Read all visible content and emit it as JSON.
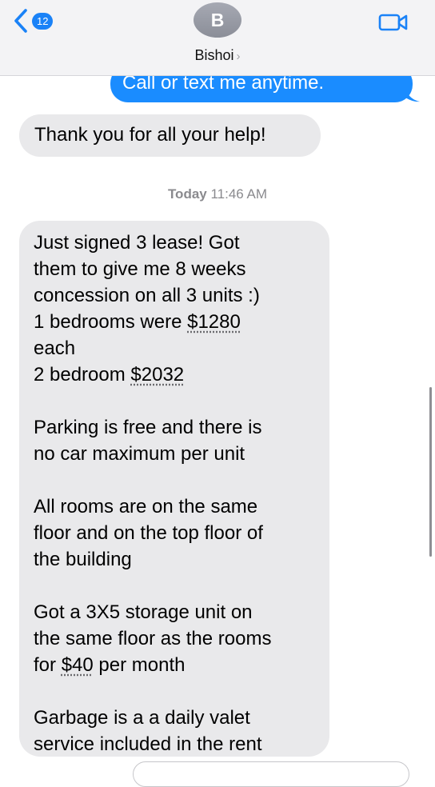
{
  "header": {
    "back_badge": "12",
    "avatar_initial": "B",
    "contact_name": "Bishoi"
  },
  "messages": {
    "sent_1": "Call or text me anytime.",
    "received_1": "Thank you for all your help!",
    "timestamp_day": "Today",
    "timestamp_time": "11:46 AM",
    "received_2": {
      "p1": {
        "l1": "Just signed 3 lease! Got",
        "l2": "them to give me 8 weeks",
        "l3": "concession on all 3 units :)",
        "l4_prefix": "1 bedrooms were ",
        "l4_amount": "$1280",
        "l5": "each",
        "l6_prefix": "2 bedroom ",
        "l6_amount": "$2032"
      },
      "p2": {
        "l1": "Parking is free and there is",
        "l2": "no car maximum per unit"
      },
      "p3": {
        "l1": "All rooms are on the same",
        "l2": "floor and on the top floor of",
        "l3": "the building"
      },
      "p4": {
        "l1": "Got a 3X5 storage unit on",
        "l2": "the same floor as the rooms",
        "l3_prefix": "for ",
        "l3_amount": "$40",
        "l3_suffix": " per month"
      },
      "p5": {
        "l1": "Garbage is a a daily valet",
        "l2": "service included in the rent"
      }
    }
  },
  "icons": {
    "back": "chevron-left-icon",
    "video": "video-camera-icon"
  },
  "colors": {
    "accent": "#1a82f7",
    "sent_bubble": "#1a8cff",
    "received_bubble": "#e9e9eb",
    "header_bg": "#f3f3f5"
  }
}
